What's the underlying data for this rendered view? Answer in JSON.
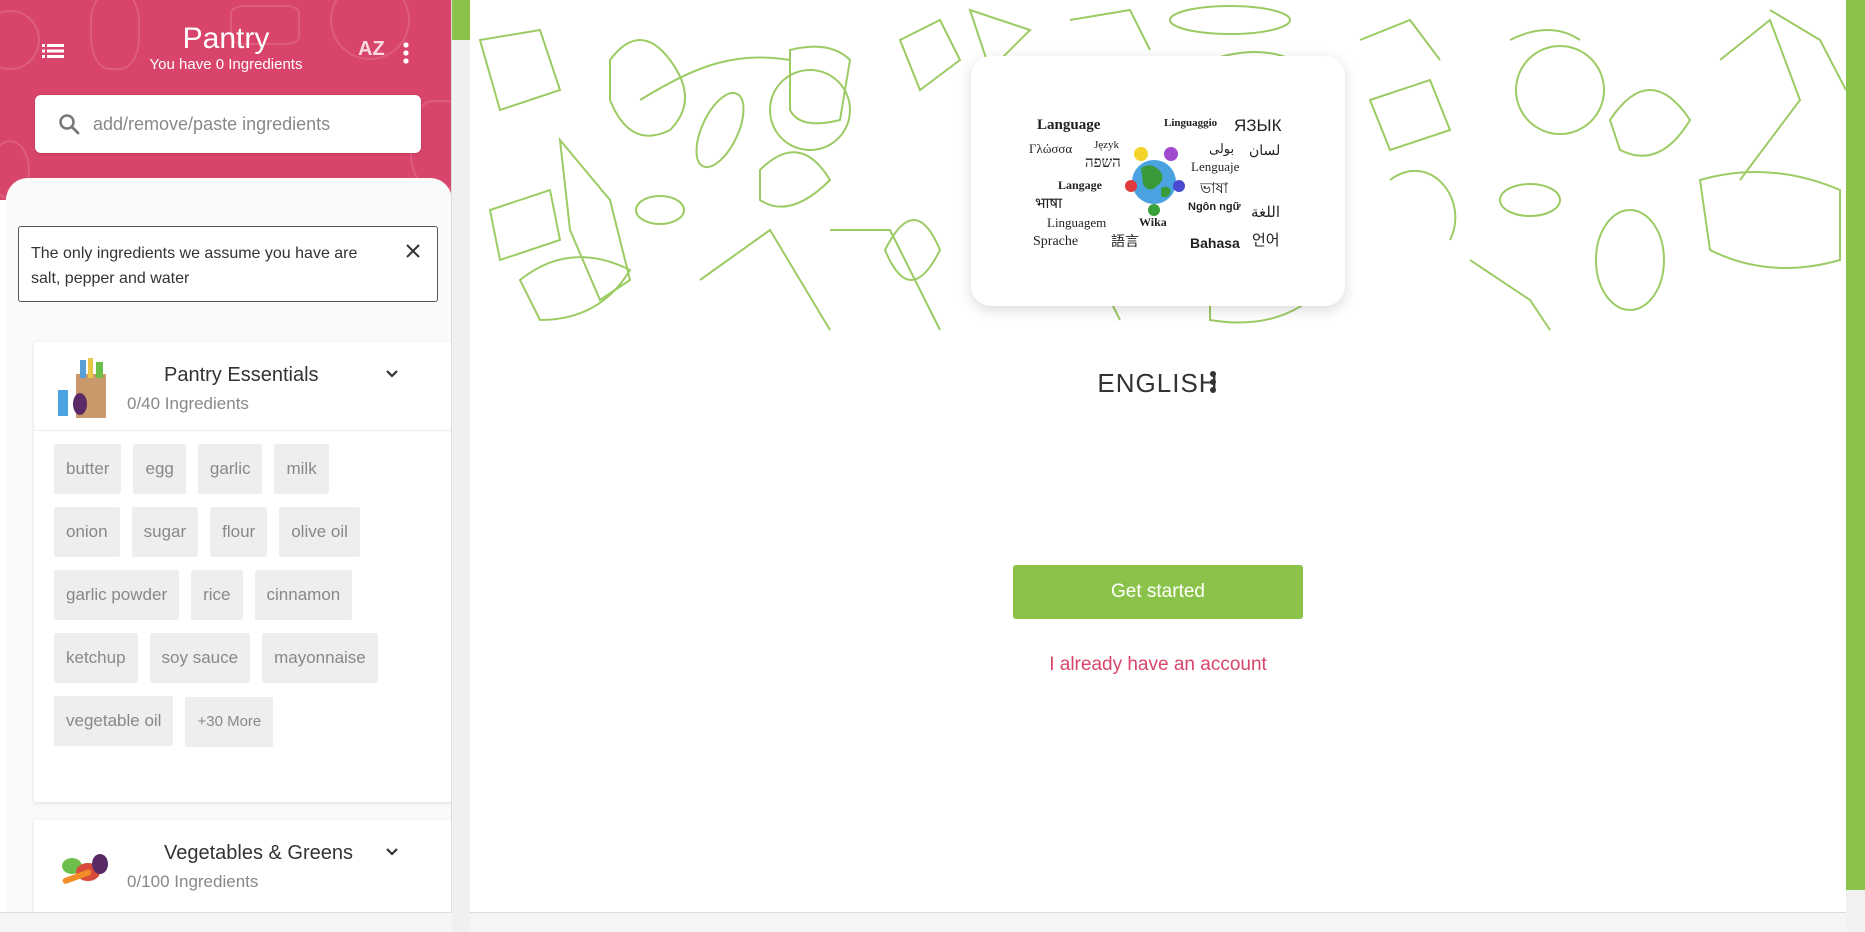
{
  "sidebar": {
    "title": "Pantry",
    "subtitle": "You have 0 Ingredients",
    "sort_label": "AZ",
    "search_placeholder": "add/remove/paste ingredients",
    "notice": "The only ingredients we assume you have are salt, pepper and water",
    "categories": [
      {
        "title": "Pantry Essentials",
        "count": "0/40 Ingredients",
        "icon": "grocery-bag-icon",
        "items": [
          "butter",
          "egg",
          "garlic",
          "milk",
          "onion",
          "sugar",
          "flour",
          "olive oil",
          "garlic powder",
          "rice",
          "cinnamon",
          "ketchup",
          "soy sauce",
          "mayonnaise",
          "vegetable oil"
        ],
        "more_label": "+30 More"
      },
      {
        "title": "Vegetables & Greens",
        "count": "0/100 Ingredients",
        "icon": "vegetables-icon"
      }
    ]
  },
  "main": {
    "language_words": [
      "Language",
      "Linguaggio",
      "ЯЗЫК",
      "Γλώσσα",
      "Język",
      "بولی",
      "لسان",
      "השפה",
      "Lenguaje",
      "Langage",
      "ভাষা",
      "भाषा",
      "Ngôn ngữ",
      "اللغة",
      "Linguagem",
      "Wika",
      "Sprache",
      "語言",
      "Bahasa",
      "언어"
    ],
    "language": "ENGLISH",
    "get_started_label": "Get started",
    "login_label": "I already have an account"
  },
  "colors": {
    "brand_pink": "#d9456a",
    "brand_green": "#8bc34a"
  }
}
